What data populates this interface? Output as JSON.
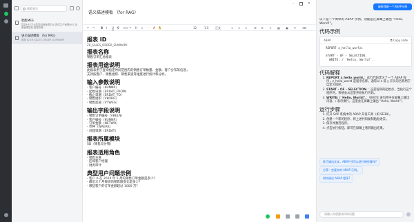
{
  "sidebar_list": {
    "search_placeholder": "搜索笔记",
    "refresh_label": "C",
    "notes": [
      {
        "title": "智能MES",
        "preview": "智能MES平台智能制造管理平台,提供生产管理MES,设备管理智能,数据采集...",
        "active": false
      },
      {
        "title": "语义描述模板 （for RAG）",
        "preview": "报表 ID\nZR_SALES_ORDER_SUMMARY",
        "active": true
      }
    ]
  },
  "editor": {
    "title": "语义描述模板 （for RAG）",
    "toolbar": {
      "font_size": "12",
      "line_height": "1.5",
      "heading_label": "正文",
      "buttons": [
        "B",
        "I",
        "U",
        "S",
        "</>",
        "❝",
        "H",
        "≡",
        "⋯",
        "A",
        "A"
      ]
    },
    "sections": [
      {
        "heading": "报表 ID",
        "lines": [
          "ZR_SALES_ORDER_SUMMARY"
        ],
        "sub": true
      },
      {
        "heading": "报表名称",
        "lines": [
          "销售订单汇总报表"
        ]
      },
      {
        "heading": "报表用途说明",
        "lines": [
          "此报表用于查询指定时间范围内的销售订单数量、金额、客户分布等信息，",
          "支持按客户、销售组织、销售渠道等维度进行统计和分析。"
        ]
      },
      {
        "heading": "输入参数说明",
        "lines": [
          "- 客户编号（KUNNR）",
          "- 起始日期（ERDAT_FROM）",
          "- 截止日期（ERDAT_TO）",
          "- 销售组织（VKORG）",
          "- 销售渠道（VTWEG）"
        ]
      },
      {
        "heading": "输出字段说明",
        "lines": [
          "- 销售订单编号（VBELN）",
          "- 客户编号（KUNNR）",
          "- 订单金额（NETWR）",
          "- 币种（WAERK）",
          "- 创建日期（ERDAT）"
        ]
      },
      {
        "heading": "报表所属模块",
        "lines": [
          "SD（销售与分销）"
        ]
      },
      {
        "heading": "报表适用角色",
        "lines": [
          "- 销售主管",
          "- 区域客户经理",
          "- 财务审计"
        ]
      },
      {
        "heading": "典型用户问题示例",
        "lines": [
          "- 客户 A 在 2024 年 5 月的销售订单金额是多少？",
          "- 最近三个月每周的销售额变化是多少？",
          "- 哪些客户的订单金额超过 1000 万？"
        ]
      }
    ]
  },
  "chat": {
    "user_message": "请给我做一个ABAP示例",
    "intro": "以下是一个简单的 ABAP 示例，功能是在屏幕上输出 \"Hello, World!\"。",
    "code_heading": "代码示例",
    "code_lang": "ABAP",
    "copy_label": "Copy code",
    "code_lines": [
      "REPORT z_hello_world.",
      "",
      "START - OF - SELECTION.",
      "  WRITE: / 'Hello, World!'."
    ],
    "explain_heading": "代码解释",
    "explain": [
      {
        "key": "REPORT z_hello_world.",
        "text": "：这行代码定义了一个 ABAP 程序，z_hello_world 是程序名称。通常以 z 或 y 开头的名称用于自定义程序。"
      },
      {
        "key": "START - OF - SELECTION.",
        "text": "：这是程序的起始点，当执行这个程序时，系统会从这里开始执行代码。"
      },
      {
        "key": "WRITE: / 'Hello, World!'.",
        "text": "：WRITE 语句用于在屏幕上输出内容，/ 表示换行，这里会在屏幕上输出 \"Hello, World!\"。"
      }
    ],
    "run_heading": "运行步骤",
    "run_steps": [
      "打开 SAP 系统中的 ABAP 开发工具（如 SE38）。",
      "创建一个新的程序，将上述代码复制粘贴进去。",
      "保存并激活程序。",
      "点击执行按钮，即可在屏幕上看到输出结果。"
    ],
    "suggestions": [
      "除了输出文本，ABAP 还可以进行哪些操作?",
      "分享一些复杂的 ABAP 示例。",
      "如何调试 ABAP 程序?"
    ],
    "input_placeholder": "请输入你想要询问的问题"
  }
}
